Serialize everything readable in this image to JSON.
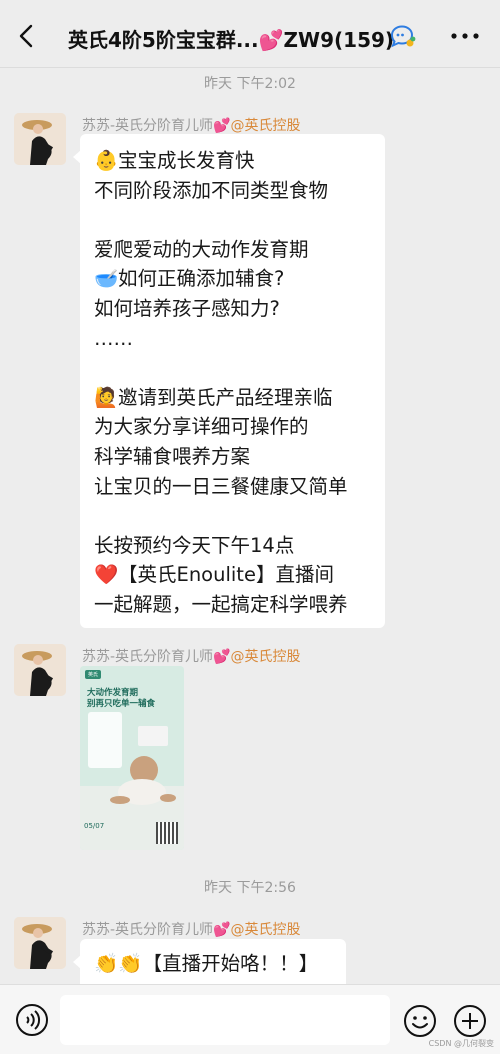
{
  "header": {
    "title": "英氏4阶5阶宝宝群...",
    "title_heart": "💕",
    "title_suffix": "ZW9(159)"
  },
  "timestamps": [
    "昨天 下午2:02",
    "昨天 下午2:56"
  ],
  "sender": {
    "name": "苏苏-英氏分阶育儿师",
    "heart": "💕",
    "corp": "@英氏控股"
  },
  "message1": {
    "lines": [
      {
        "emoji": "👶",
        "text": "宝宝成长发育快"
      },
      {
        "emoji": "",
        "text": "不同阶段添加不同类型食物"
      },
      {
        "emoji": "",
        "text": ""
      },
      {
        "emoji": "",
        "text": "爱爬爱动的大动作发育期"
      },
      {
        "emoji": "🥣",
        "text": "如何正确添加辅食?"
      },
      {
        "emoji": "",
        "text": "如何培养孩子感知力?"
      },
      {
        "emoji": "",
        "text": "……"
      },
      {
        "emoji": "",
        "text": ""
      },
      {
        "emoji": "🙋",
        "text": "邀请到英氏产品经理亲临"
      },
      {
        "emoji": "",
        "text": "为大家分享详细可操作的"
      },
      {
        "emoji": "",
        "text": "科学辅食喂养方案"
      },
      {
        "emoji": "",
        "text": "让宝贝的一日三餐健康又简单"
      },
      {
        "emoji": "",
        "text": ""
      },
      {
        "emoji": "",
        "text": "长按预约今天下午14点"
      },
      {
        "emoji": "❤️",
        "text": "【英氏Enoulite】直播间"
      },
      {
        "emoji": "",
        "text": "一起解题，一起搞定科学喂养"
      }
    ]
  },
  "image_message": {
    "poster_tag": "英氏",
    "poster_title_1": "大动作发育期",
    "poster_title_2": "别再只吃单一辅食",
    "poster_date": "05/07"
  },
  "message3": {
    "emoji": "👏👏",
    "text": "【直播开始咯！！】"
  },
  "watermark": "CSDN @几何裂变"
}
